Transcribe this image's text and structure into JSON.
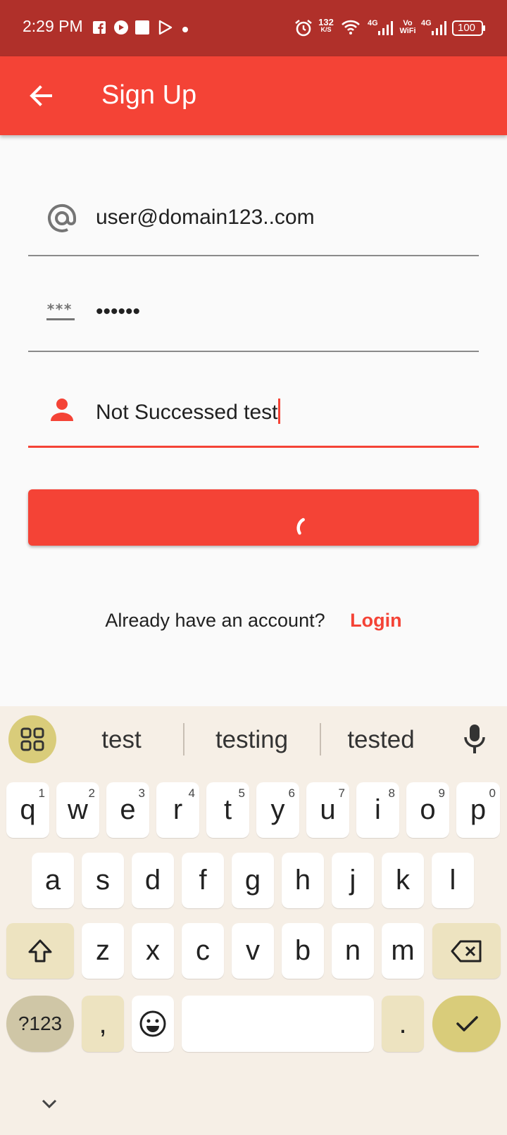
{
  "status_bar": {
    "time": "2:29 PM",
    "net_speed_value": "132",
    "net_speed_unit": "K/S",
    "network_4g_1": "4G",
    "volte_top": "Vo",
    "volte_bottom": "WiFi",
    "network_4g_2": "4G",
    "battery": "100"
  },
  "app_bar": {
    "title": "Sign Up"
  },
  "form": {
    "email_value": "user@domain123..com",
    "password_value": "••••••",
    "name_value": "Not Successed test"
  },
  "login_prompt": {
    "question": "Already have an account?",
    "link": "Login"
  },
  "keyboard": {
    "suggestions": [
      "test",
      "testing",
      "tested"
    ],
    "row1": [
      {
        "key": "q",
        "hint": "1"
      },
      {
        "key": "w",
        "hint": "2"
      },
      {
        "key": "e",
        "hint": "3"
      },
      {
        "key": "r",
        "hint": "4"
      },
      {
        "key": "t",
        "hint": "5"
      },
      {
        "key": "y",
        "hint": "6"
      },
      {
        "key": "u",
        "hint": "7"
      },
      {
        "key": "i",
        "hint": "8"
      },
      {
        "key": "o",
        "hint": "9"
      },
      {
        "key": "p",
        "hint": "0"
      }
    ],
    "row2": [
      "a",
      "s",
      "d",
      "f",
      "g",
      "h",
      "j",
      "k",
      "l"
    ],
    "row3": [
      "z",
      "x",
      "c",
      "v",
      "b",
      "n",
      "m"
    ],
    "symbols_key": "?123",
    "comma_key": ",",
    "period_key": "."
  },
  "colors": {
    "status_bar": "#b0302a",
    "primary": "#f44336",
    "keyboard_bg": "#f6efe6",
    "keyboard_accent": "#d9cc7a"
  }
}
